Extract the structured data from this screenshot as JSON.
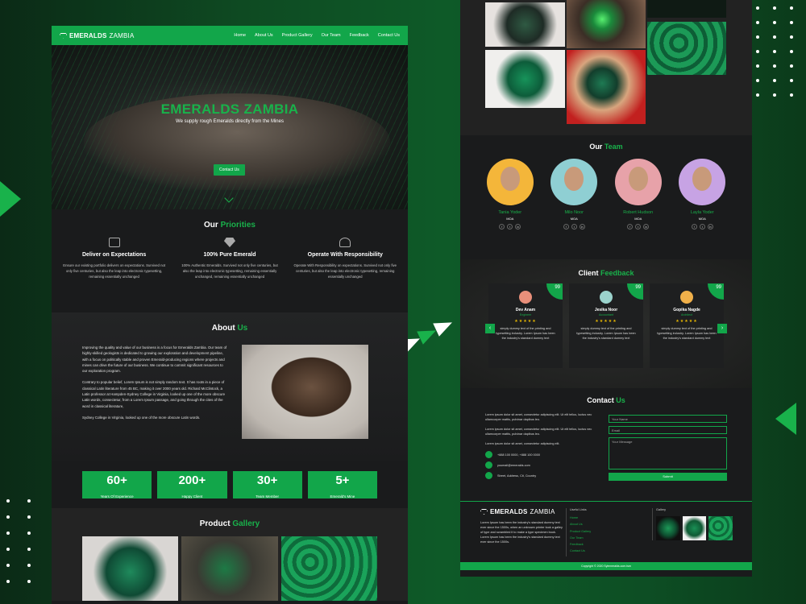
{
  "brand": {
    "name": "EMERALDS",
    "name_suffix": "ZAMBIA"
  },
  "nav": {
    "items": [
      "Home",
      "About Us",
      "Product Gallery",
      "Our Team",
      "Feedback",
      "Contact Us"
    ]
  },
  "hero": {
    "title": "EMERALDS ZAMBIA",
    "subtitle": "We supply rough Emeralds directly from the Mines",
    "cta": "Contact Us"
  },
  "priorities": {
    "title_a": "Our",
    "title_b": "Priorities",
    "items": [
      {
        "title": "Deliver on Expectations",
        "text": "Ensure our existing portfolio delivers on expectations. Survived not only five centuries, but also the leap into electronic typesetting, remaining essentially unchanged"
      },
      {
        "title": "100% Pure Emerald",
        "text": "100% Authentic Emeralds. Survived not only five centuries, but also the leap into electronic typesetting, remaining essentially unchanged, remaining essentially unchanged"
      },
      {
        "title": "Operate With Responsibility",
        "text": "Operate With Responsibility on expectations. Survived not only five centuries, but also the leap into electronic typesetting, remaining essentially unchanged"
      }
    ]
  },
  "about": {
    "title_a": "About",
    "title_b": "Us",
    "p1": "Improving the quality and value of our business is a focus for Emeralds Zambia. Our team of highly-skilled geologists is dedicated to growing our exploration and development pipeline, with a focus on politically stable and proven Emerald-producing regions where projects and mines can drive the future of our business. We continue to commit significant resources to our exploration program.",
    "p2": "Contrary to popular belief, Lorem Ipsum is not simply random text. It has roots in a piece of classical Latin literature from 45 BC, making it over 2000 years old. Richard McClintock, a Latin professor at Hampden-Sydney College in Virginia, looked up one of the more obscure Latin words, consectetur, from a Lorem Ipsum passage, and going through the cites of the word in classical literature,",
    "p3": "Sydney College in Virginia, looked up one of the more obscure Latin words."
  },
  "stats": [
    {
      "value": "60+",
      "label": "Years Of Experience"
    },
    {
      "value": "200+",
      "label": "Happy Client"
    },
    {
      "value": "30+",
      "label": "Team Member"
    },
    {
      "value": "5+",
      "label": "Emerald's Mine"
    }
  ],
  "gallery": {
    "title_a": "Product",
    "title_b": "Gallery"
  },
  "team": {
    "title_a": "Our",
    "title_b": "Team",
    "members": [
      {
        "name": "Tania Yoder",
        "role": "MOA",
        "bg": "#f4b63a"
      },
      {
        "name": "Milo Noor",
        "role": "MOA",
        "bg": "#8fcfd3"
      },
      {
        "name": "Robert Hudson",
        "role": "MOA",
        "bg": "#e7a2a9"
      },
      {
        "name": "Layla Yoder",
        "role": "MOA",
        "bg": "#c7a3e4"
      }
    ]
  },
  "feedback": {
    "title_a": "Client",
    "title_b": "Feedback",
    "quote_mark": "99",
    "stars": "★★★★★",
    "cards": [
      {
        "name": "Dev Anam",
        "role": "Engineer",
        "text": "simply dummy text of the printing and typesetting industry. Lorem Ipsum has been the industry's standard dummy text",
        "avatar": "#e98f7a"
      },
      {
        "name": "Jesika Noor",
        "role": "Accountant",
        "text": "simply dummy text of the printing and typesetting industry. Lorem Ipsum has been the industry's standard dummy text",
        "avatar": "#9bd3cc"
      },
      {
        "name": "Gopika Nagde",
        "role": "Architect",
        "text": "simply dummy text of the printing and typesetting industry. Lorem Ipsum has been the industry's standard dummy text",
        "avatar": "#f0b04a"
      }
    ]
  },
  "contact": {
    "title_a": "Contact",
    "title_b": "Us",
    "p1": "Lorem ipsum dolor sit amet, consectetur adipiscing elit. Ut elit tellus, luctus nec ullamcorper mattis, pulvinar dapibus leo.",
    "p2": "Lorem ipsum dolor sit amet, consectetur adipiscing elit. Ut elit tellus, luctus nec ullamcorper mattis, pulvinar dapibus leo.",
    "p3": "Lorem ipsum dolor sit amet, consectetur adipiscing elit.",
    "phone": "+888 100 0000, +888 100 0000",
    "email": "youmail@emeralds.com",
    "address": "Street, Address, Cit, Country",
    "form": {
      "name": "Your Name",
      "email": "Email",
      "message": "Your Message",
      "send": "Submit"
    }
  },
  "footer": {
    "about": "Lorem Ipsum has been the industry's standard dummy text ever since the 1500s, when an unknown printer took a galley of type and scrambled it to make a type specimen book. Lorem Ipsum has been the industry's standard dummy text ever since the 1500s.",
    "links_title": "Useful Links",
    "links": [
      "Home",
      "About Us",
      "Product Gallery",
      "Our Team",
      "Feedback",
      "Contact Us"
    ],
    "gallery_title": "Gallery",
    "copyright": "Copyright © 2020 Sylemeralds.com.tsm"
  }
}
